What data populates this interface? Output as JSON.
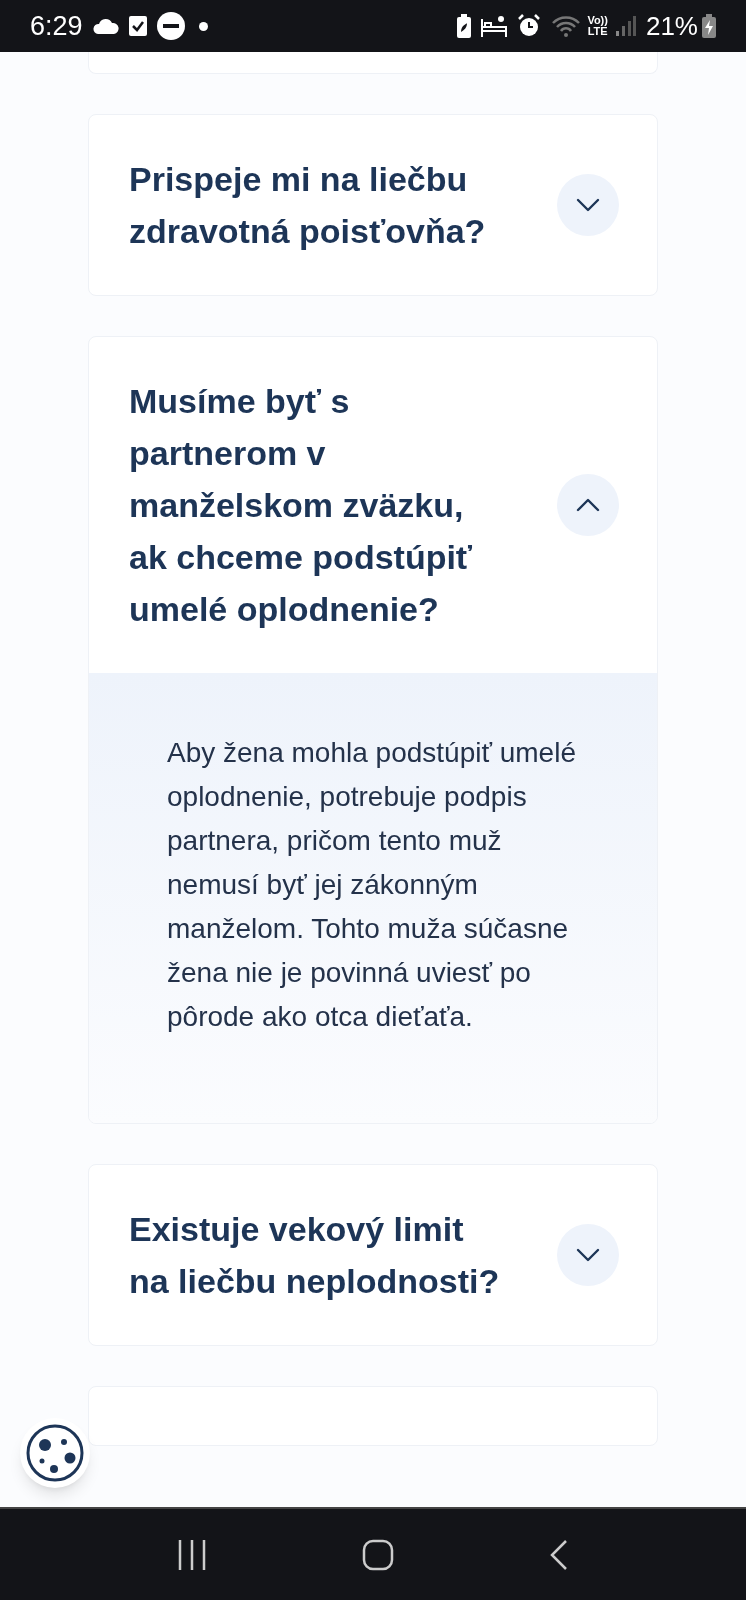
{
  "status_bar": {
    "time": "6:29",
    "volte": [
      "Vo))",
      "LTE"
    ],
    "battery": "21%"
  },
  "faq": [
    {
      "question": "Prispeje mi na liečbu zdravotná poisťovňa?",
      "expanded": false
    },
    {
      "question": "Musíme byť s partnerom v manželskom zväzku, ak chceme podstúpiť umelé oplodnenie?",
      "expanded": true,
      "answer": "Aby žena mohla podstúpiť umelé oplodnenie, potrebuje podpis partnera, pričom tento muž nemusí byť jej zákonným manželom. Tohto muža súčasne žena nie je povinná uviesť po pôrode ako otca dieťaťa."
    },
    {
      "question": "Existuje vekový limit na liečbu neplodnosti?",
      "expanded": false
    }
  ]
}
